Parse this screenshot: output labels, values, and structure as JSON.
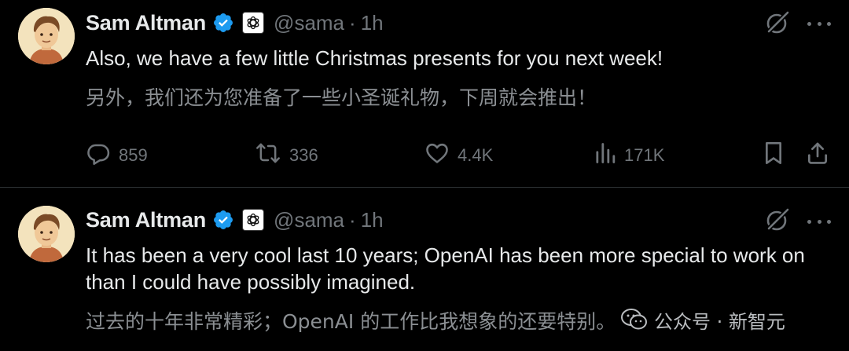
{
  "tweets": [
    {
      "author": {
        "name": "Sam Altman",
        "handle": "@sama",
        "separator": "·",
        "time": "1h",
        "verified_icon": "verified-badge-icon",
        "affiliate_icon": "openai-logo-icon",
        "avatar_icon": "cartoon-avatar-icon"
      },
      "text_en": "Also, we have a few little Christmas presents for you next week!",
      "text_zh": "另外，我们还为您准备了一些小圣诞礼物，下周就会推出！",
      "actions": {
        "replies": "859",
        "reposts": "336",
        "likes": "4.4K",
        "views": "171K"
      }
    },
    {
      "author": {
        "name": "Sam Altman",
        "handle": "@sama",
        "separator": "·",
        "time": "1h",
        "verified_icon": "verified-badge-icon",
        "affiliate_icon": "openai-logo-icon",
        "avatar_icon": "cartoon-avatar-icon"
      },
      "text_en": "It has been a very cool last 10 years; OpenAI has been more special to work on than I could have possibly imagined.",
      "text_zh": "过去的十年非常精彩；OpenAI 的工作比我想象的还要特别。"
    }
  ],
  "watermark": {
    "text": "公众号 · 新智元",
    "icon": "wechat-icon"
  },
  "colors": {
    "background": "#000000",
    "primary_text": "#e7e9ea",
    "secondary_text": "#71767b",
    "verified_blue": "#1d9bf0",
    "divider": "#2f3336"
  }
}
